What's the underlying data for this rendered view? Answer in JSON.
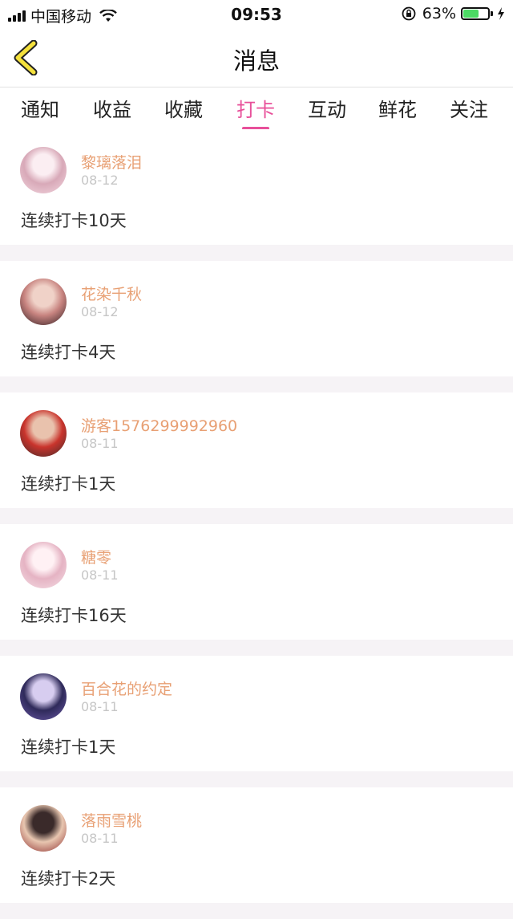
{
  "status": {
    "carrier": "中国移动",
    "time": "09:53",
    "battery": "63%",
    "battery_level": 0.63
  },
  "nav": {
    "title": "消息"
  },
  "tabs": [
    {
      "label": "通知"
    },
    {
      "label": "收益"
    },
    {
      "label": "收藏"
    },
    {
      "label": "打卡",
      "active": true
    },
    {
      "label": "互动"
    },
    {
      "label": "鲜花"
    },
    {
      "label": "关注"
    }
  ],
  "items": [
    {
      "name": "黎璃落泪",
      "date": "08-12",
      "message": "连续打卡10天",
      "avatar_colors": [
        "#f3d7e0",
        "#d8a9b8",
        "#fbeef2"
      ]
    },
    {
      "name": "花染千秋",
      "date": "08-12",
      "message": "连续打卡4天",
      "avatar_colors": [
        "#2b1a1f",
        "#c7837f",
        "#f0d2c8"
      ]
    },
    {
      "name": "游客1576299992960",
      "date": "08-11",
      "message": "连续打卡1天",
      "avatar_colors": [
        "#3c2a2a",
        "#c9342c",
        "#e9c2ad"
      ]
    },
    {
      "name": "糖零",
      "date": "08-11",
      "message": "连续打卡16天",
      "avatar_colors": [
        "#f5dfe6",
        "#e5b3c3",
        "#fff1f4"
      ]
    },
    {
      "name": "百合花的约定",
      "date": "08-11",
      "message": "连续打卡1天",
      "avatar_colors": [
        "#6b5aa8",
        "#2f2a5a",
        "#d7cdf0"
      ]
    },
    {
      "name": "落雨雪桃",
      "date": "08-11",
      "message": "连续打卡2天",
      "avatar_colors": [
        "#8c2c2c",
        "#e8c6b0",
        "#3a2a2a"
      ]
    }
  ],
  "colors": {
    "accent": "#e8509a",
    "name": "#e8a074",
    "date": "#c6c6c6",
    "back_icon_fill": "#f4e13c"
  }
}
